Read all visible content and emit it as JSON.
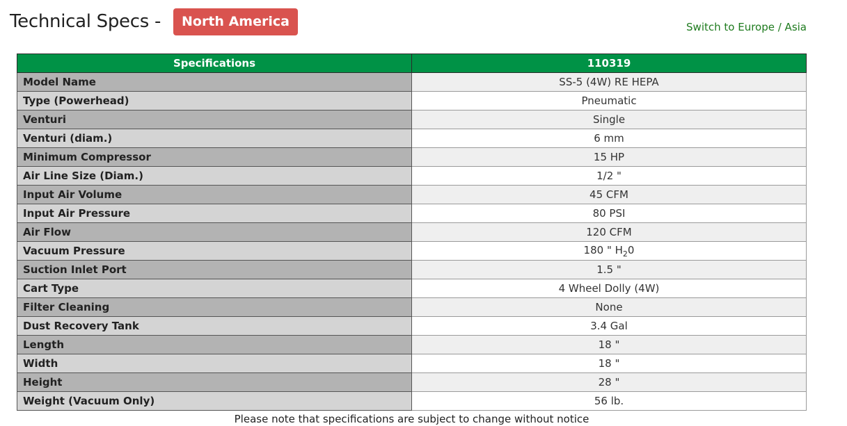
{
  "header": {
    "title": "Technical Specs - ",
    "region_badge": "North America",
    "switch_link": "Switch to Europe / Asia"
  },
  "table": {
    "columns": [
      "Specifications",
      "110319"
    ],
    "rows": [
      {
        "label": "Model Name",
        "value": "SS-5 (4W) RE HEPA"
      },
      {
        "label": "Type (Powerhead)",
        "value": "Pneumatic"
      },
      {
        "label": "Venturi",
        "value": "Single"
      },
      {
        "label": "Venturi (diam.)",
        "value": "6 mm"
      },
      {
        "label": "Minimum Compressor",
        "value": "15 HP"
      },
      {
        "label": "Air Line Size (Diam.)",
        "value": "1/2 \""
      },
      {
        "label": "Input Air Volume",
        "value": "45 CFM"
      },
      {
        "label": "Input Air Pressure",
        "value": "80 PSI"
      },
      {
        "label": "Air Flow",
        "value": "120 CFM"
      },
      {
        "label": "Vacuum Pressure",
        "value": "180 \" H",
        "value_sub": "2",
        "value_suffix": "0"
      },
      {
        "label": "Suction Inlet Port",
        "value": "1.5 \""
      },
      {
        "label": "Cart Type",
        "value": "4 Wheel Dolly (4W)"
      },
      {
        "label": "Filter Cleaning",
        "value": "None"
      },
      {
        "label": "Dust Recovery Tank",
        "value": "3.4 Gal"
      },
      {
        "label": "Length",
        "value": "18 \""
      },
      {
        "label": "Width",
        "value": "18 \""
      },
      {
        "label": "Height",
        "value": "28 \""
      },
      {
        "label": "Weight (Vacuum Only)",
        "value": "56 lb."
      }
    ]
  },
  "notice": "Please note that specifications are subject to change without notice",
  "colors": {
    "header_green": "#009246",
    "badge_red": "#d9534f",
    "link_green": "#1e7b1e"
  }
}
